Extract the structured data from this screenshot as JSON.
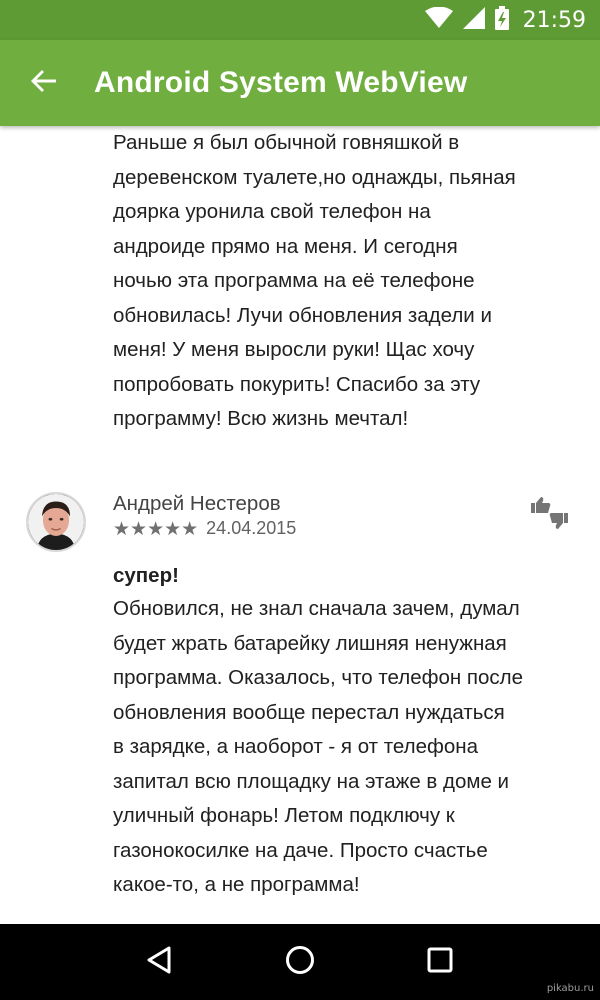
{
  "status_bar": {
    "time": "21:59",
    "icons": [
      "wifi-icon",
      "signal-icon",
      "battery-charging-icon"
    ],
    "color": "#5e9b34"
  },
  "app_bar": {
    "title": "Android System WebView",
    "back_icon": "arrow-back-icon",
    "color": "#6fae3f"
  },
  "reviews": [
    {
      "text": "Раньше я был обычной говняшкой в\nдеревенском туалете,но однажды, пьяная\nдоярка уронила свой телефон на\nандроиде прямо на меня. И сегодня\nночью эта программа на её телефоне\nобновилась! Лучи обновления задели и\nменя! У меня выросли руки! Щас хочу\nпопробовать покурить! Спасибо за эту\nпрограмму! Всю жизнь мечтал!"
    },
    {
      "author": "Андрей Нестеров",
      "stars": "★★★★★",
      "rating": 5,
      "date": "24.04.2015",
      "title": "супер!",
      "text": "Обновился, не знал сначала зачем, думал\nбудет жрать батарейку лишняя ненужная\nпрограмма. Оказалось, что телефон после\nобновления вообще перестал нуждаться\nв зарядке, а наоборот - я от телефона\nзапитал всю площадку на этаже в доме и\nуличный фонарь! Летом подключу к\nгазонокосилке на даче. Просто счастье\nкакое-то, а не программа!"
    }
  ],
  "nav_bar": {
    "icons": [
      "back-triangle-icon",
      "home-circle-icon",
      "recents-square-icon"
    ]
  },
  "watermark": "pikabu.ru"
}
